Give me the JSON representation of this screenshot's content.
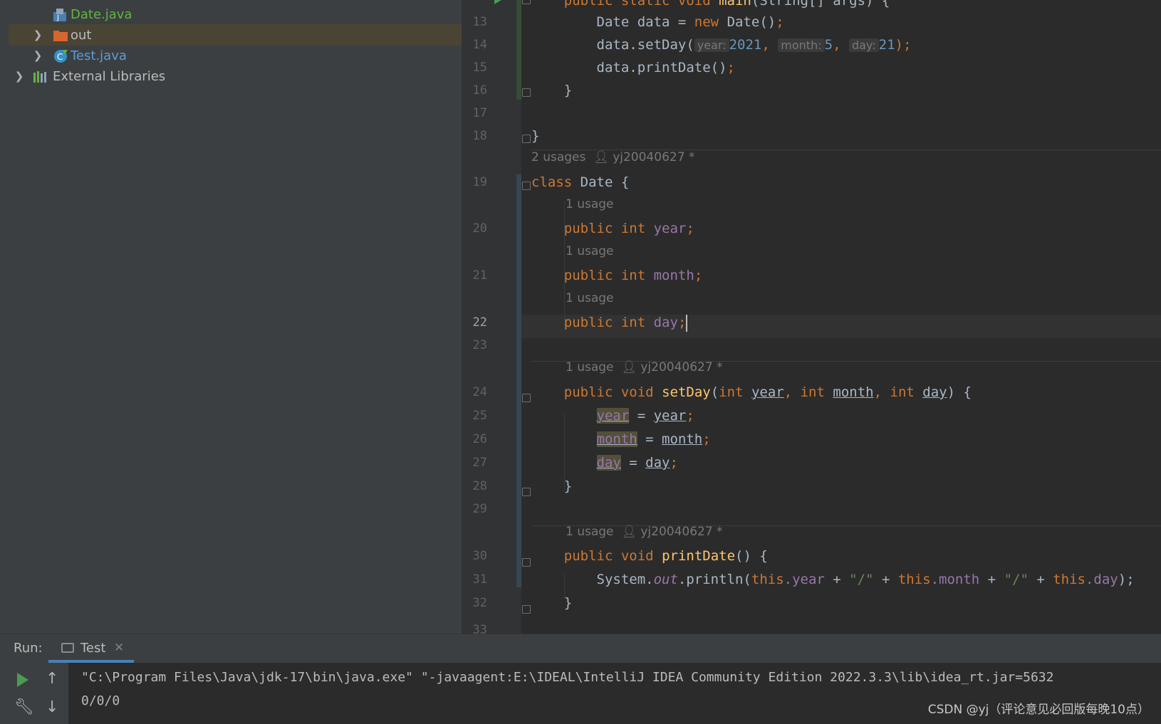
{
  "project_tree": {
    "items": [
      {
        "label": "Date.java",
        "icon": "java-class-icon"
      },
      {
        "label": "out",
        "icon": "folder-icon"
      },
      {
        "label": "Test.java",
        "icon": "java-class-icon"
      },
      {
        "label": "External Libraries",
        "icon": "libraries-icon"
      }
    ]
  },
  "editor": {
    "line_numbers": [
      "13",
      "14",
      "15",
      "16",
      "17",
      "18",
      "19",
      "20",
      "21",
      "22",
      "23",
      "24",
      "25",
      "26",
      "27",
      "28",
      "29",
      "30",
      "31",
      "32",
      "33"
    ],
    "current_line": "22",
    "code": {
      "l13": {
        "a": "Date data = ",
        "b": "new",
        "c": " Date()",
        "d": ";"
      },
      "l14": {
        "a": "data.setDay(",
        "h1": "year:",
        "v1": "2021",
        "s1": ",",
        "h2": "month:",
        "v2": "5",
        "s2": ",",
        "h3": "day:",
        "v3": "21",
        "e": ");"
      },
      "l15": {
        "a": "data.printDate()",
        "b": ";"
      },
      "l16": "}",
      "l18": "}",
      "l19": {
        "kw": "class",
        "rest": " Date {"
      },
      "l20": {
        "kw": "public int",
        "f": "year",
        "e": ";"
      },
      "l21": {
        "kw": "public int",
        "f": "month",
        "e": ";"
      },
      "l22": {
        "kw": "public int",
        "f": "day",
        "e": ";"
      },
      "l24": {
        "kw": "public void",
        "m": "setDay",
        "p0": "(",
        "t1": "int",
        "p1": "year",
        "c1": ",",
        "t2": "int",
        "p2": "month",
        "c2": ",",
        "t3": "int",
        "p3": "day",
        "e": ") {"
      },
      "l25": {
        "f": "year",
        "op": " = ",
        "p": "year",
        "e": ";"
      },
      "l26": {
        "f": "month",
        "op": " = ",
        "p": "month",
        "e": ";"
      },
      "l27": {
        "f": "day",
        "op": " = ",
        "p": "day",
        "e": ";"
      },
      "l28": "}",
      "l30": {
        "kw": "public void",
        "m": "printDate",
        "e": "() {"
      },
      "l31": {
        "a": "System.",
        "st": "out",
        "b": ".println(",
        "t1": "this",
        "f1": ".year",
        "plus1": " + ",
        "s1": "\"/\"",
        "plus2": " + ",
        "t2": "this",
        "f2": ".month",
        "plus3": " + ",
        "s2": "\"/\"",
        "plus4": " + ",
        "t3": "this",
        "f3": ".day",
        "e": ");"
      },
      "l32": "}"
    },
    "inlays": {
      "date_class": {
        "usages": "2 usages",
        "author": "yj20040627 *"
      },
      "year_field": "1 usage",
      "month_field": "1 usage",
      "day_field": "1 usage",
      "setday": {
        "usages": "1 usage",
        "author": "yj20040627 *"
      },
      "printdate": {
        "usages": "1 usage",
        "author": "yj20040627 *"
      }
    }
  },
  "run_panel": {
    "title": "Run:",
    "tab": "Test",
    "console_lines": [
      "\"C:\\Program Files\\Java\\jdk-17\\bin\\java.exe\" \"-javaagent:E:\\IDEAL\\IntelliJ IDEA Community Edition 2022.3.3\\lib\\idea_rt.jar=5632",
      "0/0/0"
    ]
  },
  "watermark": "CSDN @yj（评论意见必回版每晚10点）",
  "colors": {
    "keyword": "#cc7832",
    "field": "#9876aa",
    "number": "#6897bb",
    "string": "#6a8759",
    "method": "#ffc66d",
    "text": "#a9b7c6"
  }
}
